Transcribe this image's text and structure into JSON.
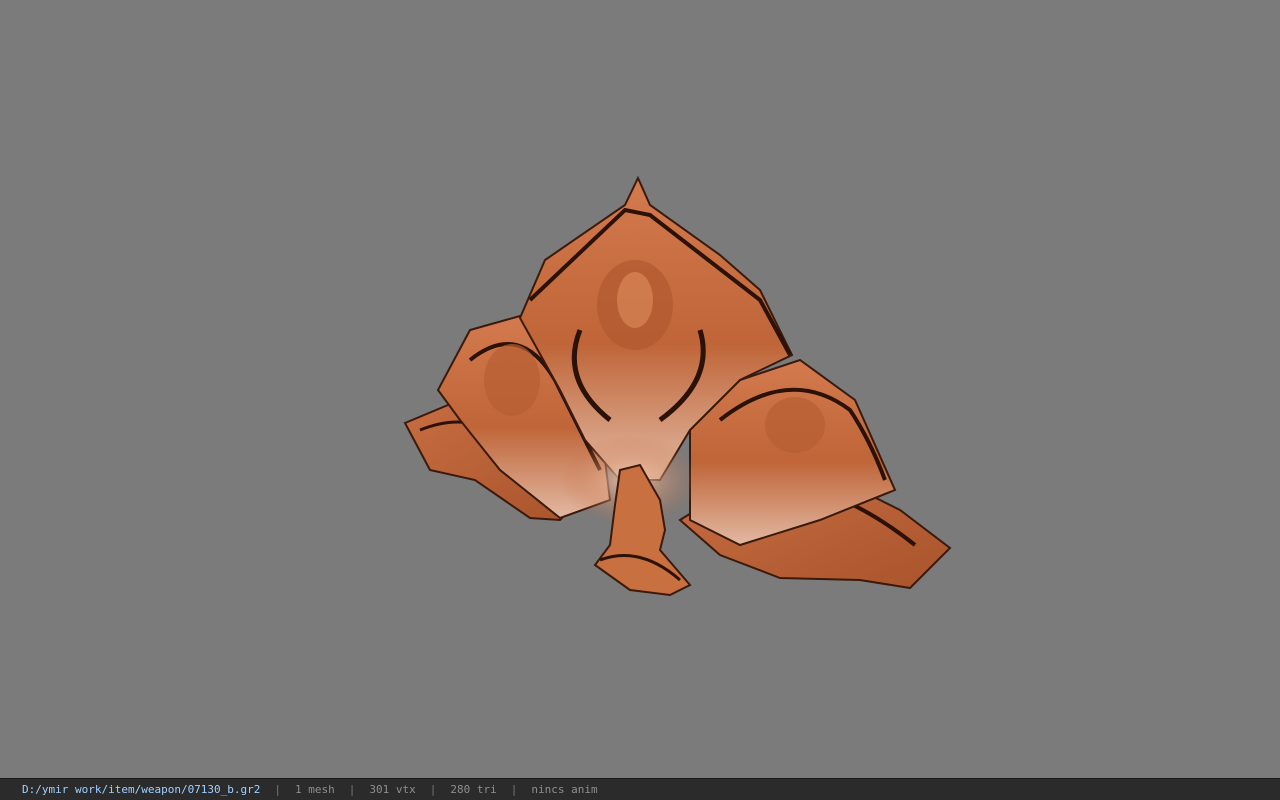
{
  "viewer": {
    "viewport_background": "#7b7b7b",
    "model_name_icon": "shield-item-model",
    "model_color": "#c4683c"
  },
  "status": {
    "path": "D:/ymir work/item/weapon/07130_b.gr2",
    "separator": "|",
    "mesh": "1 mesh",
    "vertices": "301 vtx",
    "triangles": "280 tri",
    "anim": "nincs anim"
  }
}
